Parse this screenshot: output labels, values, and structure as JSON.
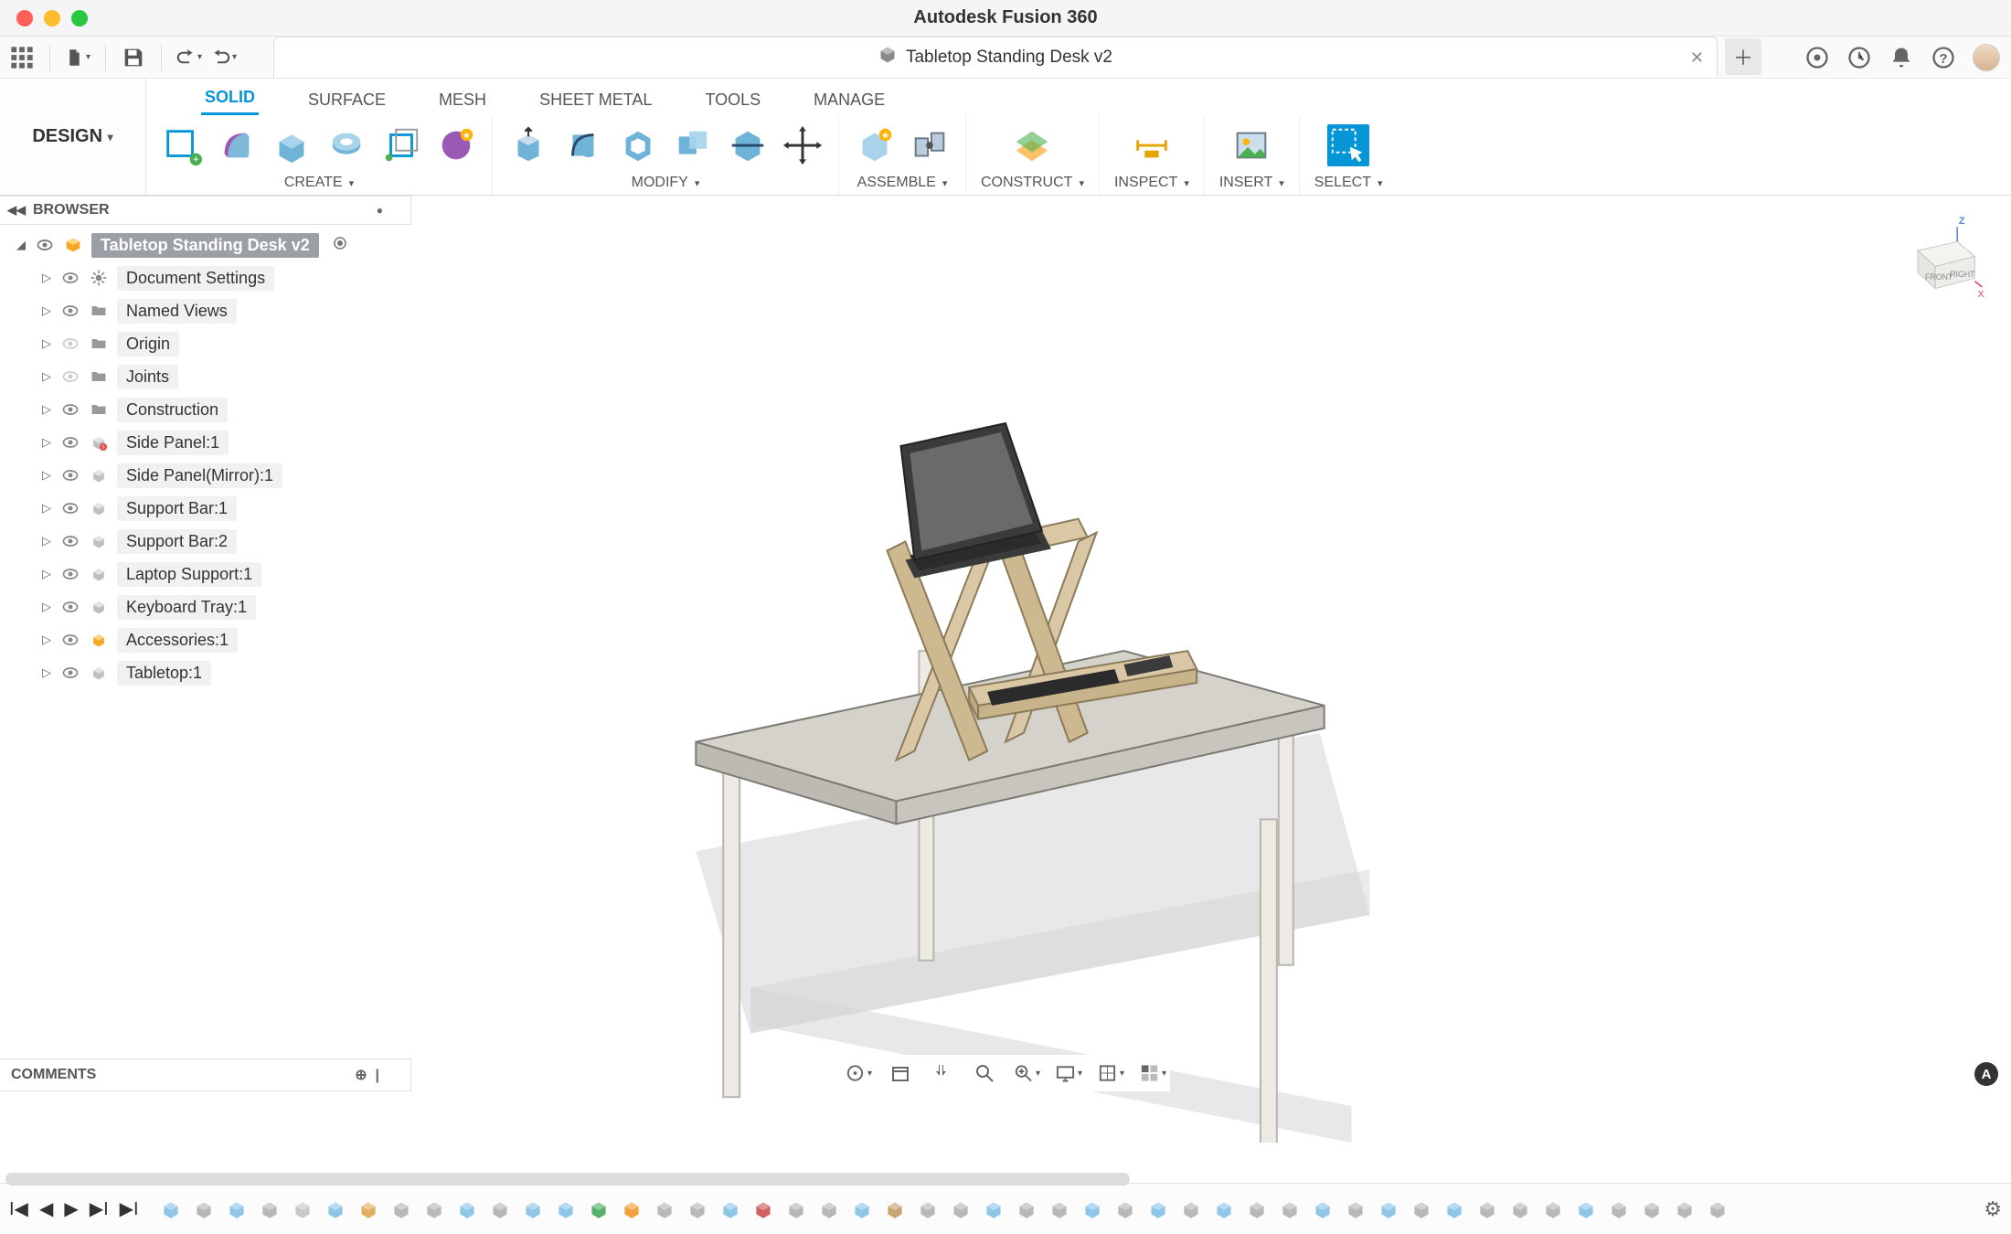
{
  "app": {
    "title": "Autodesk Fusion 360"
  },
  "document": {
    "tab_title": "Tabletop Standing Desk v2"
  },
  "workspace": {
    "label": "DESIGN"
  },
  "ribbon": {
    "tabs": [
      "SOLID",
      "SURFACE",
      "MESH",
      "SHEET METAL",
      "TOOLS",
      "MANAGE"
    ],
    "active_tab": 0,
    "groups": {
      "create": "CREATE",
      "modify": "MODIFY",
      "assemble": "ASSEMBLE",
      "construct": "CONSTRUCT",
      "inspect": "INSPECT",
      "insert": "INSERT",
      "select": "SELECT"
    }
  },
  "browser": {
    "title": "BROWSER",
    "root": "Tabletop Standing Desk v2",
    "items": [
      {
        "label": "Document Settings",
        "icon": "gear"
      },
      {
        "label": "Named Views",
        "icon": "folder"
      },
      {
        "label": "Origin",
        "icon": "folder",
        "dim": true
      },
      {
        "label": "Joints",
        "icon": "folder",
        "dim": true
      },
      {
        "label": "Construction",
        "icon": "folder"
      },
      {
        "label": "Side Panel:1",
        "icon": "component-warn"
      },
      {
        "label": "Side Panel(Mirror):1",
        "icon": "component"
      },
      {
        "label": "Support Bar:1",
        "icon": "component"
      },
      {
        "label": "Support Bar:2",
        "icon": "component"
      },
      {
        "label": "Laptop Support:1",
        "icon": "component"
      },
      {
        "label": "Keyboard Tray:1",
        "icon": "component"
      },
      {
        "label": "Accessories:1",
        "icon": "assembly"
      },
      {
        "label": "Tabletop:1",
        "icon": "component"
      }
    ]
  },
  "comments": {
    "title": "COMMENTS"
  },
  "viewcube": {
    "front": "FRONT",
    "right": "RIGHT",
    "z": "Z",
    "x": "X"
  },
  "colors": {
    "accent": "#0696d7",
    "wood": "#d9c7a6",
    "table": "#d8d6cf",
    "leg": "#eceae3",
    "laptop_body": "#3b3b3b",
    "laptop_screen": "#6a6a6a",
    "shadow": "#cfcfcf"
  }
}
